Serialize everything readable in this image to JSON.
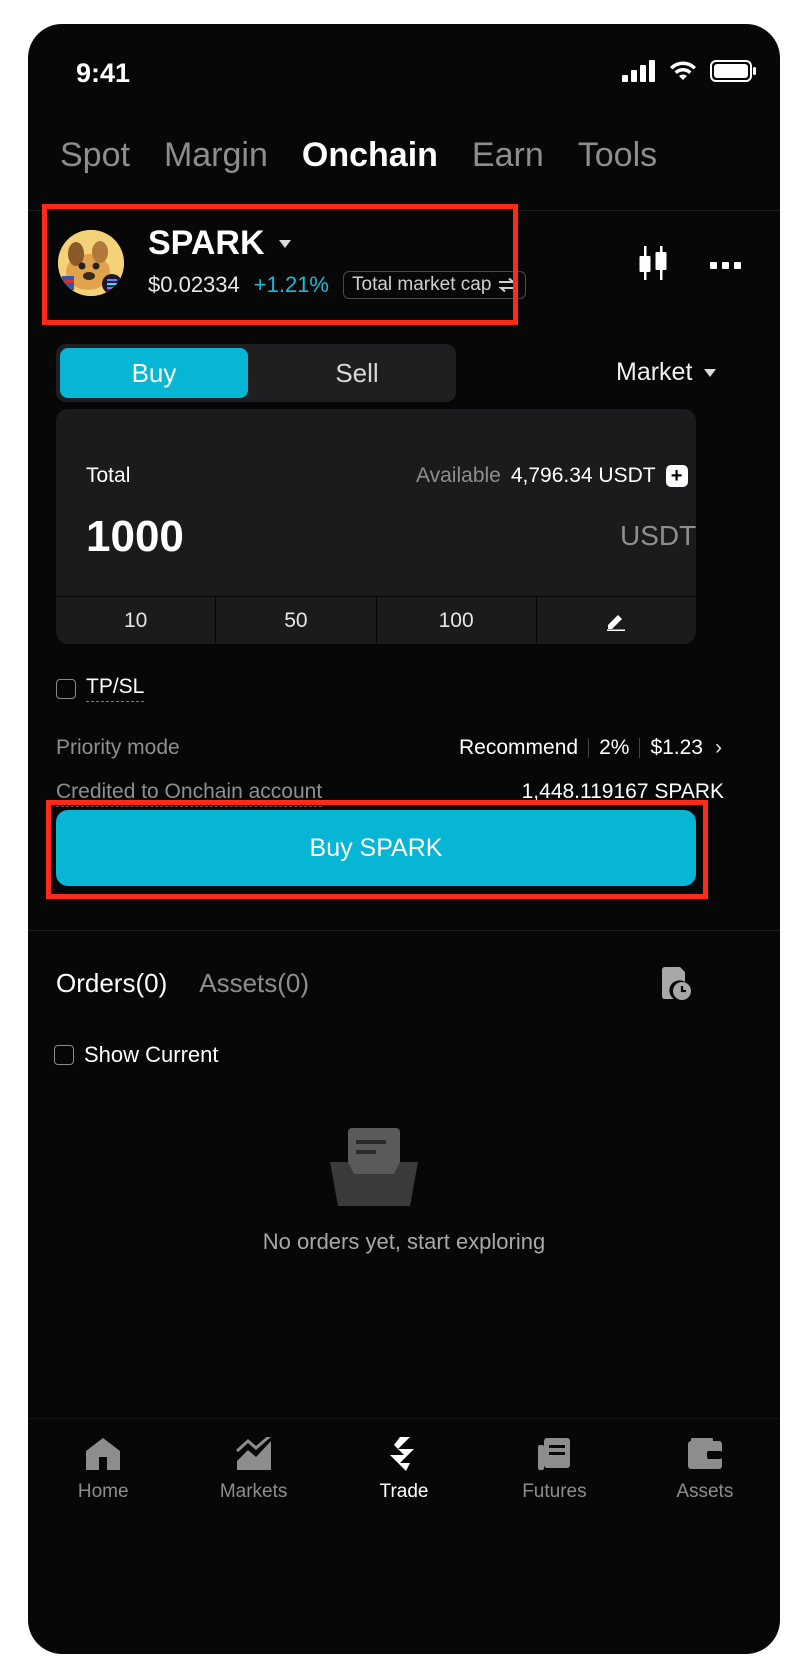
{
  "status_bar": {
    "time": "9:41"
  },
  "top_tabs": [
    {
      "label": "Spot",
      "active": false
    },
    {
      "label": "Margin",
      "active": false
    },
    {
      "label": "Onchain",
      "active": true
    },
    {
      "label": "Earn",
      "active": false
    },
    {
      "label": "Tools",
      "active": false
    }
  ],
  "token": {
    "name": "SPARK",
    "price": "$0.02334",
    "change": "+1.21%",
    "badge": "Total market cap"
  },
  "trade": {
    "buy_label": "Buy",
    "sell_label": "Sell",
    "order_type": "Market",
    "total_label": "Total",
    "available_label": "Available",
    "available_value": "4,796.34 USDT",
    "amount": "1000",
    "unit": "USDT",
    "quick_amounts": [
      "10",
      "50",
      "100"
    ],
    "tpsl_label": "TP/SL",
    "priority_label": "Priority mode",
    "priority_mode": "Recommend",
    "priority_pct": "2%",
    "priority_fee": "$1.23",
    "credited_label": "Credited to Onchain account",
    "credited_value": "1,448.119167 SPARK",
    "buy_button": "Buy SPARK"
  },
  "orders": {
    "orders_tab": "Orders(0)",
    "assets_tab": "Assets(0)",
    "show_current": "Show Current",
    "empty_text": "No orders yet, start exploring"
  },
  "bottom_nav": [
    {
      "label": "Home",
      "icon": "home-icon"
    },
    {
      "label": "Markets",
      "icon": "markets-icon"
    },
    {
      "label": "Trade",
      "icon": "trade-icon",
      "active": true
    },
    {
      "label": "Futures",
      "icon": "futures-icon"
    },
    {
      "label": "Assets",
      "icon": "wallet-icon"
    }
  ],
  "colors": {
    "accent": "#06b6d4",
    "highlight": "#ff2a1a",
    "background": "#070707"
  }
}
